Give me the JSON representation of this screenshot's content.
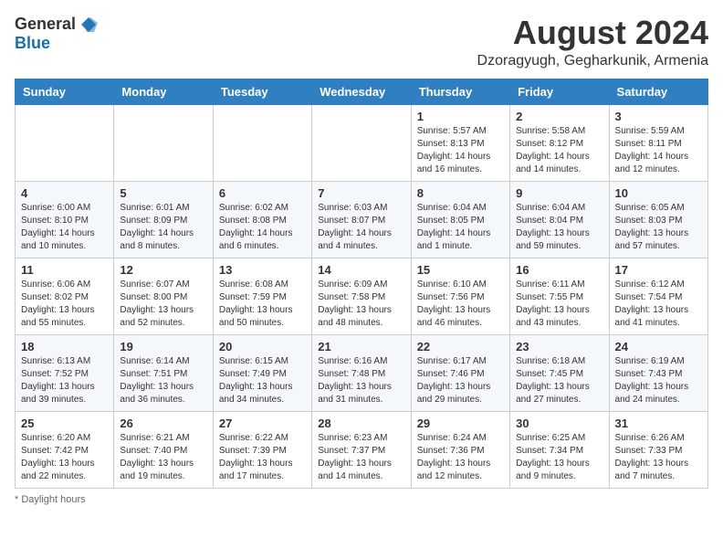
{
  "header": {
    "logo_general": "General",
    "logo_blue": "Blue",
    "month_year": "August 2024",
    "location": "Dzoragyugh, Gegharkunik, Armenia"
  },
  "days_of_week": [
    "Sunday",
    "Monday",
    "Tuesday",
    "Wednesday",
    "Thursday",
    "Friday",
    "Saturday"
  ],
  "footer": {
    "daylight_note": "Daylight hours"
  },
  "weeks": [
    [
      {
        "day": "",
        "info": ""
      },
      {
        "day": "",
        "info": ""
      },
      {
        "day": "",
        "info": ""
      },
      {
        "day": "",
        "info": ""
      },
      {
        "day": "1",
        "info": "Sunrise: 5:57 AM\nSunset: 8:13 PM\nDaylight: 14 hours\nand 16 minutes."
      },
      {
        "day": "2",
        "info": "Sunrise: 5:58 AM\nSunset: 8:12 PM\nDaylight: 14 hours\nand 14 minutes."
      },
      {
        "day": "3",
        "info": "Sunrise: 5:59 AM\nSunset: 8:11 PM\nDaylight: 14 hours\nand 12 minutes."
      }
    ],
    [
      {
        "day": "4",
        "info": "Sunrise: 6:00 AM\nSunset: 8:10 PM\nDaylight: 14 hours\nand 10 minutes."
      },
      {
        "day": "5",
        "info": "Sunrise: 6:01 AM\nSunset: 8:09 PM\nDaylight: 14 hours\nand 8 minutes."
      },
      {
        "day": "6",
        "info": "Sunrise: 6:02 AM\nSunset: 8:08 PM\nDaylight: 14 hours\nand 6 minutes."
      },
      {
        "day": "7",
        "info": "Sunrise: 6:03 AM\nSunset: 8:07 PM\nDaylight: 14 hours\nand 4 minutes."
      },
      {
        "day": "8",
        "info": "Sunrise: 6:04 AM\nSunset: 8:05 PM\nDaylight: 14 hours\nand 1 minute."
      },
      {
        "day": "9",
        "info": "Sunrise: 6:04 AM\nSunset: 8:04 PM\nDaylight: 13 hours\nand 59 minutes."
      },
      {
        "day": "10",
        "info": "Sunrise: 6:05 AM\nSunset: 8:03 PM\nDaylight: 13 hours\nand 57 minutes."
      }
    ],
    [
      {
        "day": "11",
        "info": "Sunrise: 6:06 AM\nSunset: 8:02 PM\nDaylight: 13 hours\nand 55 minutes."
      },
      {
        "day": "12",
        "info": "Sunrise: 6:07 AM\nSunset: 8:00 PM\nDaylight: 13 hours\nand 52 minutes."
      },
      {
        "day": "13",
        "info": "Sunrise: 6:08 AM\nSunset: 7:59 PM\nDaylight: 13 hours\nand 50 minutes."
      },
      {
        "day": "14",
        "info": "Sunrise: 6:09 AM\nSunset: 7:58 PM\nDaylight: 13 hours\nand 48 minutes."
      },
      {
        "day": "15",
        "info": "Sunrise: 6:10 AM\nSunset: 7:56 PM\nDaylight: 13 hours\nand 46 minutes."
      },
      {
        "day": "16",
        "info": "Sunrise: 6:11 AM\nSunset: 7:55 PM\nDaylight: 13 hours\nand 43 minutes."
      },
      {
        "day": "17",
        "info": "Sunrise: 6:12 AM\nSunset: 7:54 PM\nDaylight: 13 hours\nand 41 minutes."
      }
    ],
    [
      {
        "day": "18",
        "info": "Sunrise: 6:13 AM\nSunset: 7:52 PM\nDaylight: 13 hours\nand 39 minutes."
      },
      {
        "day": "19",
        "info": "Sunrise: 6:14 AM\nSunset: 7:51 PM\nDaylight: 13 hours\nand 36 minutes."
      },
      {
        "day": "20",
        "info": "Sunrise: 6:15 AM\nSunset: 7:49 PM\nDaylight: 13 hours\nand 34 minutes."
      },
      {
        "day": "21",
        "info": "Sunrise: 6:16 AM\nSunset: 7:48 PM\nDaylight: 13 hours\nand 31 minutes."
      },
      {
        "day": "22",
        "info": "Sunrise: 6:17 AM\nSunset: 7:46 PM\nDaylight: 13 hours\nand 29 minutes."
      },
      {
        "day": "23",
        "info": "Sunrise: 6:18 AM\nSunset: 7:45 PM\nDaylight: 13 hours\nand 27 minutes."
      },
      {
        "day": "24",
        "info": "Sunrise: 6:19 AM\nSunset: 7:43 PM\nDaylight: 13 hours\nand 24 minutes."
      }
    ],
    [
      {
        "day": "25",
        "info": "Sunrise: 6:20 AM\nSunset: 7:42 PM\nDaylight: 13 hours\nand 22 minutes."
      },
      {
        "day": "26",
        "info": "Sunrise: 6:21 AM\nSunset: 7:40 PM\nDaylight: 13 hours\nand 19 minutes."
      },
      {
        "day": "27",
        "info": "Sunrise: 6:22 AM\nSunset: 7:39 PM\nDaylight: 13 hours\nand 17 minutes."
      },
      {
        "day": "28",
        "info": "Sunrise: 6:23 AM\nSunset: 7:37 PM\nDaylight: 13 hours\nand 14 minutes."
      },
      {
        "day": "29",
        "info": "Sunrise: 6:24 AM\nSunset: 7:36 PM\nDaylight: 13 hours\nand 12 minutes."
      },
      {
        "day": "30",
        "info": "Sunrise: 6:25 AM\nSunset: 7:34 PM\nDaylight: 13 hours\nand 9 minutes."
      },
      {
        "day": "31",
        "info": "Sunrise: 6:26 AM\nSunset: 7:33 PM\nDaylight: 13 hours\nand 7 minutes."
      }
    ]
  ]
}
